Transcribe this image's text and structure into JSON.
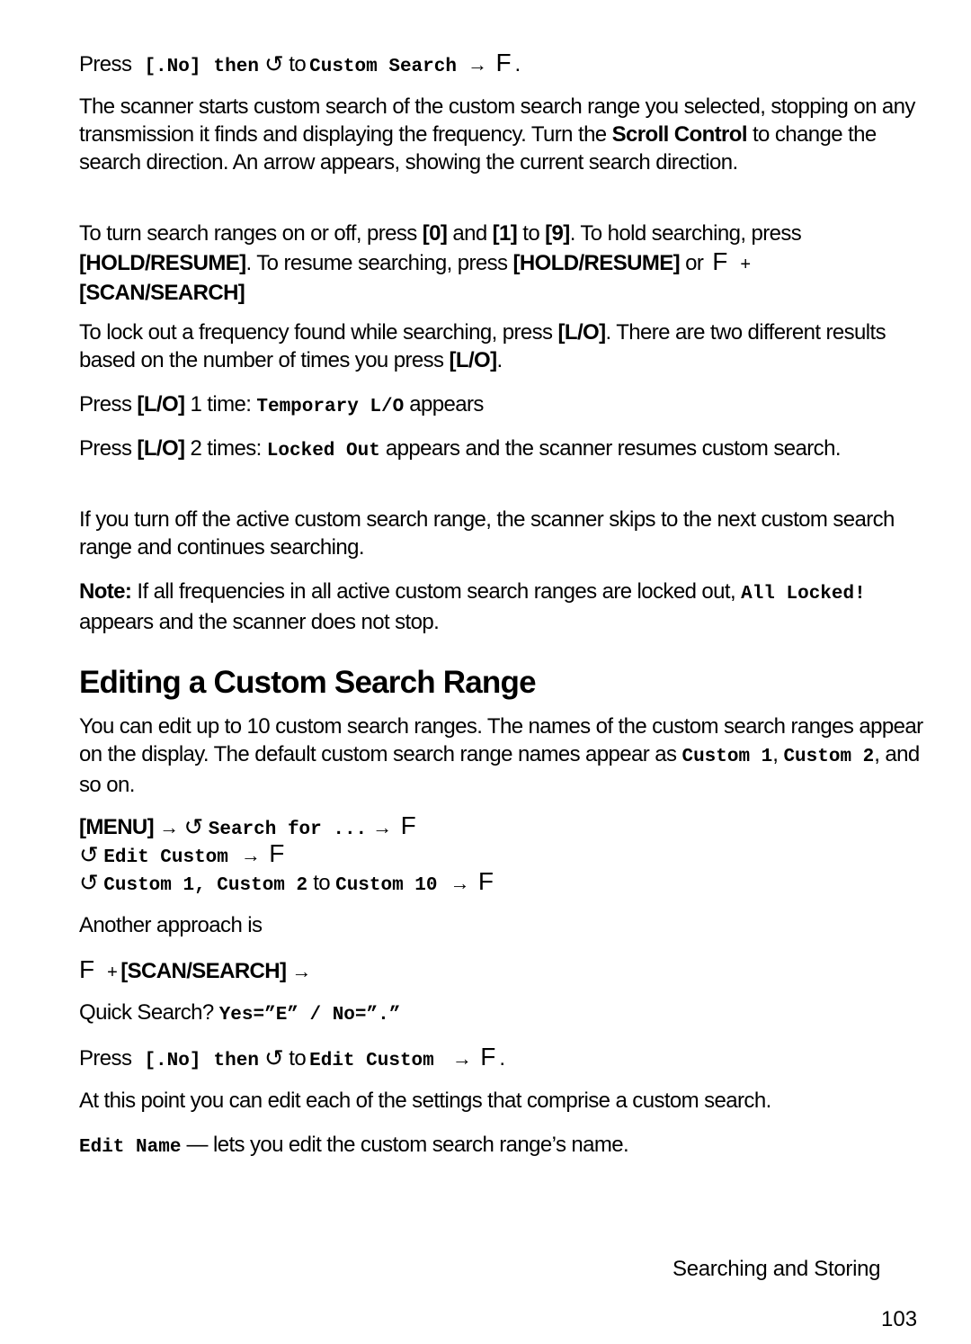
{
  "step1": {
    "press": "Press",
    "key": "[.No]",
    "then": "then",
    "to": "to",
    "target": "Custom Search",
    "f": "F",
    "end": "."
  },
  "para1": {
    "text1": "The scanner starts custom search of the custom search range you selected, stopping on any transmission it finds and displaying the frequency. Turn the ",
    "bold1": "Scroll Control",
    "text2": " to change the search direction. An arrow appears, showing the current search direction."
  },
  "para2": {
    "t1": "To turn search ranges on or off, press ",
    "k0": "[0]",
    "t2": " and ",
    "k1": "[1]",
    "t3": " to ",
    "k9": "[9]",
    "t4": ". To hold searching, press ",
    "kHold": "[HOLD/RESUME]",
    "t5": ". To resume searching, press ",
    "kHold2": "[HOLD/RESUME]",
    "t6": " or",
    "f": "F",
    "plus": "+",
    "kScan": "[SCAN/SEARCH]"
  },
  "para3": {
    "t1": "To lock out a frequency found while searching, press ",
    "k1": "[L/O]",
    "t2": ". There are two different results based on the number of times you press ",
    "k2": "[L/O]",
    "t3": "."
  },
  "para4": {
    "t1": "Press ",
    "k": "[L/O]",
    "t2": " 1 time: ",
    "mono": "Temporary L/O",
    "t3": " appears"
  },
  "para5": {
    "t1": "Press ",
    "k": "[L/O]",
    "t2": " 2 times: ",
    "mono": "Locked Out",
    "t3": " appears and the scanner resumes custom search."
  },
  "para6": {
    "text": "If you turn off the active custom search range, the scanner skips to the next custom search range and continues searching."
  },
  "note": {
    "label": "Note:",
    "t1": " If all frequencies in all active custom search ranges are locked out, ",
    "mono": "All Locked!",
    "t2": " appears and the scanner does not stop."
  },
  "heading": "Editing a Custom Search Range",
  "para7": {
    "t1": "You can edit up to 10 custom search ranges. The names of the custom search ranges appear on the display. The default custom search range names appear as ",
    "m1": "Custom 1",
    "t2": ", ",
    "m2": "Custom 2",
    "t3": ", and so on."
  },
  "menu_steps": {
    "menu": "[MENU]",
    "search_for": "Search for ...",
    "edit_custom": "Edit Custom",
    "custom_range_start": "Custom 1, Custom 2",
    "to": "to",
    "custom_range_end": "Custom 10",
    "f": "F"
  },
  "another": "Another approach is",
  "alt_step": {
    "f": "F",
    "plus": "+",
    "key": "[SCAN/SEARCH]"
  },
  "quick": {
    "t1": "Quick Search? ",
    "mono": "Yes=”E” / No=”.”"
  },
  "step2": {
    "press": "Press",
    "key": "[.No]",
    "then": "then",
    "to": "to",
    "target": "Edit Custom",
    "f": "F",
    "end": "."
  },
  "para8": "At this point you can edit each of the settings that comprise a custom search.",
  "edit_name": {
    "mono": "Edit Name",
    "t": " — lets you edit the custom search range’s name."
  },
  "footer": {
    "section": "Searching and Storing",
    "page": "103"
  },
  "icons": {
    "scroll": "↺",
    "arrow": "→"
  }
}
